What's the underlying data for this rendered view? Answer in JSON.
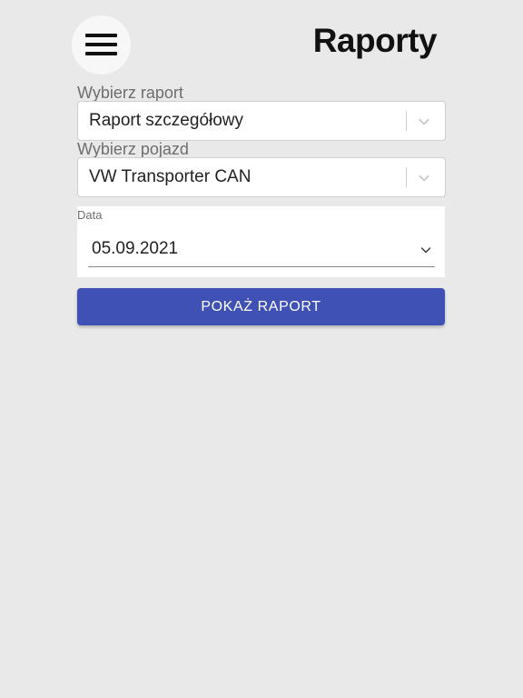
{
  "header": {
    "title": "Raporty",
    "menu_icon": "hamburger-menu-icon"
  },
  "form": {
    "report": {
      "label": "Wybierz raport",
      "value": "Raport szczegółowy"
    },
    "vehicle": {
      "label": "Wybierz pojazd",
      "value": "VW Transporter CAN"
    },
    "date": {
      "label": "Data",
      "value": "05.09.2021"
    },
    "submit_label": "POKAŻ RAPORT"
  },
  "colors": {
    "background": "#e9e9e9",
    "primary_button": "#3f51b5",
    "title_text": "#111111",
    "label_text": "#6e6e6e"
  }
}
